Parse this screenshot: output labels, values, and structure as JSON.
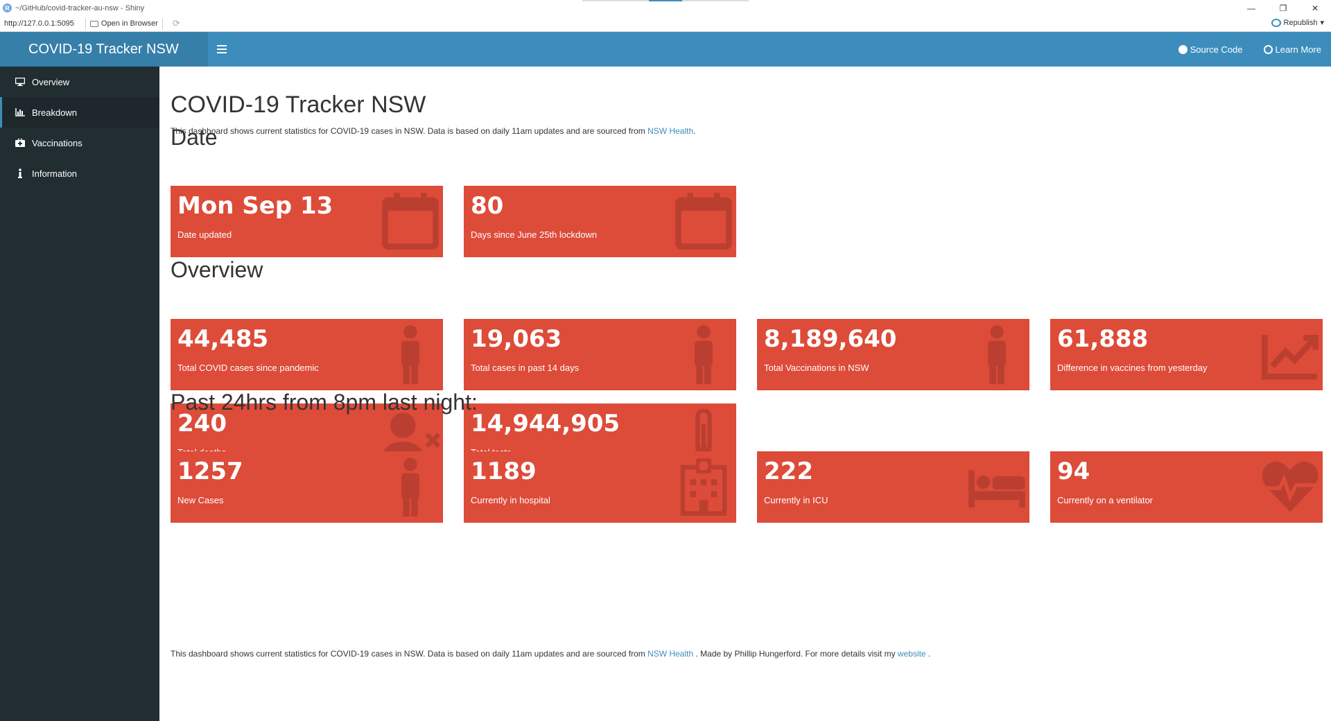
{
  "window": {
    "title": "~/GitHub/covid-tracker-au-nsw - Shiny",
    "url": "http://127.0.0.1:5095",
    "open_in_browser": "Open in Browser",
    "republish": "Republish"
  },
  "header": {
    "brand": "COVID-19 Tracker NSW",
    "links": [
      {
        "label": "Source Code",
        "icon": "github-icon"
      },
      {
        "label": "Learn More",
        "icon": "globe-icon"
      }
    ]
  },
  "sidebar": {
    "items": [
      {
        "label": "Overview",
        "icon": "desktop-icon",
        "active": false
      },
      {
        "label": "Breakdown",
        "icon": "bar-chart-icon",
        "active": true
      },
      {
        "label": "Vaccinations",
        "icon": "medkit-icon",
        "active": false
      },
      {
        "label": "Information",
        "icon": "info-icon",
        "active": false
      }
    ]
  },
  "main": {
    "title": "COVID-19 Tracker NSW",
    "intro_text": "This dashboard shows current statistics for COVID-19 cases in NSW. Data is based on daily 11am updates and are sourced from ",
    "intro_link": "NSW Health",
    "intro_end": ".",
    "sections": {
      "date": "Date",
      "overview": "Overview",
      "past24": "Past 24hrs from 8pm last night:"
    },
    "date_boxes": [
      {
        "value": "Mon Sep 13",
        "label": "Date updated",
        "icon": "calendar-icon"
      },
      {
        "value": "80",
        "label": "Days since June 25th lockdown",
        "icon": "calendar-icon"
      }
    ],
    "overview_boxes": [
      {
        "value": "44,485",
        "label": "Total COVID cases since pandemic",
        "icon": "person-icon"
      },
      {
        "value": "19,063",
        "label": "Total cases in past 14 days",
        "icon": "person-icon"
      },
      {
        "value": "8,189,640",
        "label": "Total Vaccinations in NSW",
        "icon": "person-icon"
      },
      {
        "value": "61,888",
        "label": "Difference in vaccines from yesterday",
        "icon": "chart-line-icon"
      },
      {
        "value": "240",
        "label": "Total deaths",
        "icon": "user-times-icon"
      },
      {
        "value": "14,944,905",
        "label": "Total tests",
        "icon": "thermometer-icon"
      }
    ],
    "past24_boxes": [
      {
        "value": "1257",
        "label": "New Cases",
        "icon": "person-icon"
      },
      {
        "value": "1189",
        "label": "Currently in hospital",
        "icon": "hospital-icon"
      },
      {
        "value": "222",
        "label": "Currently in ICU",
        "icon": "bed-icon"
      },
      {
        "value": "94",
        "label": "Currently on a ventilator",
        "icon": "heartbeat-icon"
      }
    ],
    "footer": {
      "text1": "This dashboard shows current statistics for COVID-19 cases in NSW. Data is based on daily 11am updates and are sourced from ",
      "link1": "NSW Health",
      "text2": " . Made by Phillip Hungerford. For more details visit my ",
      "link2": "website",
      "text3": " ."
    }
  },
  "colors": {
    "header": "#3c8dbc",
    "logo_bg": "#367fa9",
    "sidebar": "#222d32",
    "value_box": "#dd4b39"
  }
}
